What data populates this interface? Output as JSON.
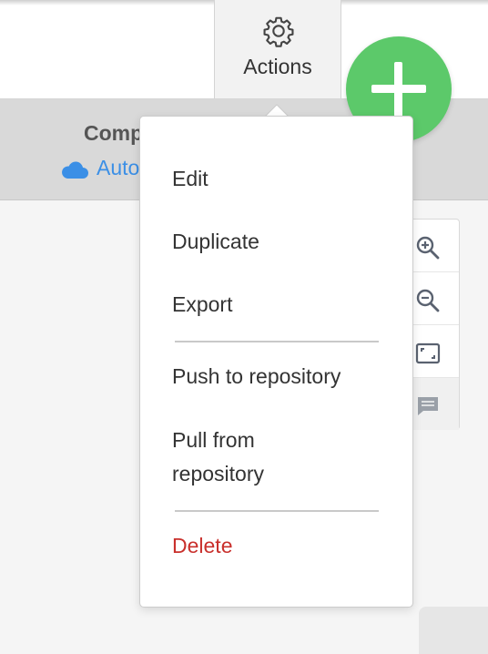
{
  "header": {
    "actions_label": "Actions",
    "actions_icon": "gear-icon",
    "fab_icon": "plus-icon",
    "fab_color": "#5cc96a"
  },
  "subheader": {
    "title_partial": "Comp",
    "link_partial": "Auto",
    "link_icon": "cloud-icon",
    "link_color": "#3b8fe6"
  },
  "menu": {
    "items": [
      {
        "label": "Edit"
      },
      {
        "label": "Duplicate"
      },
      {
        "label": "Export"
      },
      {
        "label": "Push to repository"
      },
      {
        "label": "Pull from repository"
      },
      {
        "label": "Delete",
        "danger": true
      }
    ],
    "danger_color": "#c9302c"
  },
  "zoom_controls": {
    "icons": [
      "zoom-in-icon",
      "zoom-out-icon",
      "fit-screen-icon",
      "comment-icon"
    ]
  }
}
